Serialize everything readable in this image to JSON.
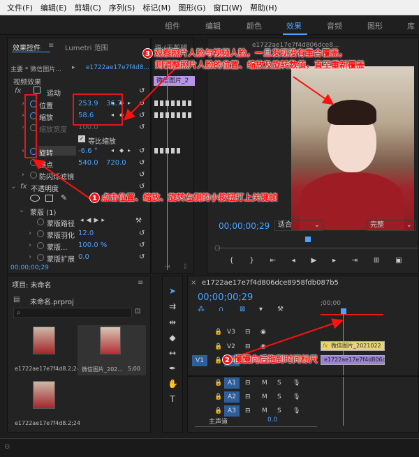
{
  "menu": [
    "文件(F)",
    "编辑(E)",
    "剪辑(C)",
    "序列(S)",
    "标记(M)",
    "图形(G)",
    "窗口(W)",
    "帮助(H)"
  ],
  "workspaces": [
    "组件",
    "编辑",
    "颜色",
    "效果",
    "音频",
    "图形",
    "库"
  ],
  "effect_controls": {
    "tab": "效果控件",
    "lumetri_tab": "Lumetri 范围",
    "source_tab": "源:(无剪辑",
    "master_label": "主要 * 微信图片...",
    "clip_name": "e1722ae17e7f4d8...",
    "video_effects": "视频效果",
    "motion": "运动",
    "position_label": "位置",
    "position_x": "253.9",
    "position_y": "36.7",
    "scale_label": "缩放",
    "scale_value": "58.6",
    "scale_width_label": "缩放宽度",
    "scale_width_value": "100.0",
    "uniform_scale": "等比缩放",
    "rotation_label": "旋转",
    "rotation_value": "-6.6 °",
    "anchor_label": "锚点",
    "anchor_x": "540.0",
    "anchor_y": "720.0",
    "anti_flicker": "防闪烁滤镜",
    "opacity": "不透明度",
    "mask": "蒙版 (1)",
    "mask_path": "蒙版路径",
    "mask_feather": "蒙版羽化",
    "mask_feather_value": "12.0",
    "mask_opacity": "蒙版...",
    "mask_opacity_value": "100.0 %",
    "mask_expansion": "蒙版扩展",
    "mask_expansion_value": "0.0",
    "timecode": "00;00;00;29",
    "clip_on_timeline": "微信图片_2"
  },
  "program": {
    "header_clip": "e1722ae17e7f4d806dce8...",
    "timecode": "00;00;00;29",
    "fit": "适合",
    "quality": "完整"
  },
  "project": {
    "title": "项目: 未命名",
    "file": "未命名.prproj",
    "items": [
      {
        "name": "e1722ae17e7f4d8...",
        "duration": "2;24"
      },
      {
        "name": "微信图片_202...",
        "duration": "5;00"
      },
      {
        "name": "e1722ae17e7f4d8...",
        "duration": "2;24"
      }
    ]
  },
  "timeline": {
    "sequence": "e1722ae17e7f4d806dce8958fdb087b5",
    "timecode": "00;00;00;29",
    "ruler_start": ";00;00",
    "tracks_video": [
      "V3",
      "V2",
      "V1"
    ],
    "v1_target": "V1",
    "tracks_audio": [
      "A1",
      "A2",
      "A3"
    ],
    "master": "主声道",
    "master_value": "0.0",
    "clip_v2": "微信图片_2021022",
    "clip_v1": "e1722ae17e7f4d806d"
  },
  "annotations": {
    "n1": "1",
    "a1": "点击位置、缩放、旋转左侧的小按钮打上关键帧",
    "n2": "2",
    "a2": "慢慢向后拖到时间标尺",
    "n3": "3",
    "a3_line1": "观察照片人脸与视频人脸，一旦发现没有重合覆盖，",
    "a3_line2": "则调整照片人脸的位置、缩放及旋转数值，直至重新覆盖"
  },
  "colors": {
    "accent": "#4aa3ff",
    "annotation": "#ff1010",
    "track_blue": "#2f5f9a",
    "clip_purple": "#9b84d1"
  }
}
